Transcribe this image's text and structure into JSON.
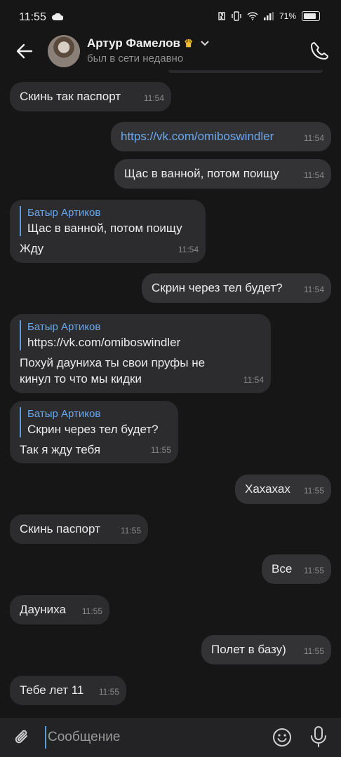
{
  "status": {
    "time": "11:55",
    "battery": "71%"
  },
  "header": {
    "name": "Артур Фамелов",
    "last_seen": "был в сети недавно"
  },
  "messages": [
    {
      "text": "Скинь так паспорт",
      "time": "11:54"
    },
    {
      "text": "https://vk.com/omiboswindler",
      "time": "11:54"
    },
    {
      "text": "Щас в ванной, потом поищу",
      "time": "11:54"
    },
    {
      "reply_name": "Батыр Артиков",
      "reply_text": "Щас в ванной, потом поищу",
      "text": "Жду",
      "time": "11:54"
    },
    {
      "text": "Скрин через тел будет?",
      "time": "11:54"
    },
    {
      "reply_name": "Батыр Артиков",
      "reply_text": "https://vk.com/omiboswindler",
      "text": "Похуй дауниха ты свои пруфы не кинул то что мы кидки",
      "time": "11:54"
    },
    {
      "reply_name": "Батыр Артиков",
      "reply_text": "Скрин через тел будет?",
      "text": "Так я жду тебя",
      "time": "11:55"
    },
    {
      "text": "Хахахах",
      "time": "11:55"
    },
    {
      "text": "Скинь паспорт",
      "time": "11:55"
    },
    {
      "text": "Все",
      "time": "11:55"
    },
    {
      "text": "Дауниха",
      "time": "11:55"
    },
    {
      "text": "Полет в базу)",
      "time": "11:55"
    },
    {
      "text": "Тебе лет 11",
      "time": "11:55"
    }
  ],
  "input": {
    "placeholder": "Сообщение"
  },
  "colors": {
    "link": "#6aa8ec",
    "reply_bar": "#5b9be0",
    "crown": "#f1c232"
  },
  "icons": [
    "back-arrow-icon",
    "crown-icon",
    "chevron-down-icon",
    "phone-icon",
    "paperclip-icon",
    "emoji-icon",
    "microphone-icon"
  ]
}
